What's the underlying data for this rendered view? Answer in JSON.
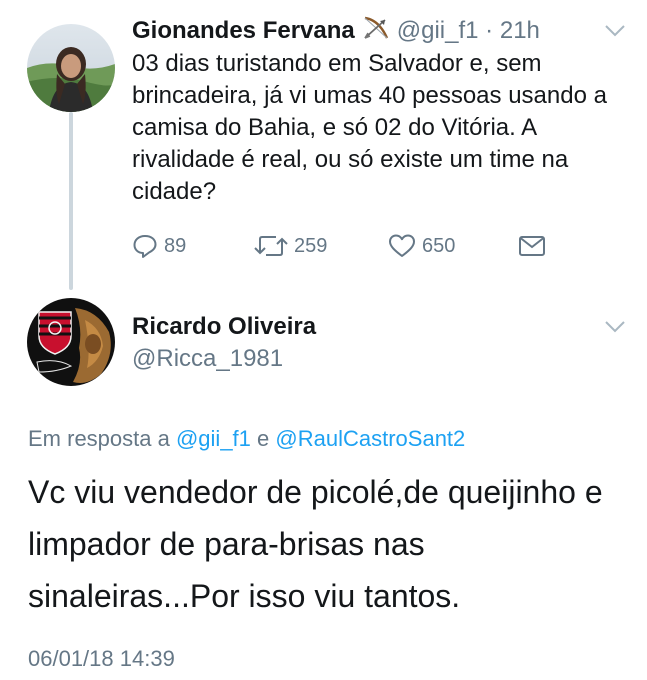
{
  "tweet1": {
    "display_name": "Gionandes Fervana",
    "emoji": "bow-and-arrow-icon",
    "handle": "@gii_f1",
    "separator": "·",
    "time": "21h",
    "text": "03 dias turistando em Salvador e, sem brincadeira, já vi umas 40 pessoas usando a camisa do Bahia, e só 02 do Vitória. A rivalidade é real, ou só existe um time na cidade?",
    "replies": "89",
    "retweets": "259",
    "likes": "650"
  },
  "tweet2": {
    "display_name": "Ricardo Oliveira",
    "handle": "@Ricca_1981",
    "reply_prefix": "Em resposta a",
    "reply_mention_1": "@gii_f1",
    "reply_conjunction": "e",
    "reply_mention_2": "@RaulCastroSant2",
    "text": "Vc viu vendedor de picolé,de queijinho e limpador de para-brisas nas sinaleiras...Por isso viu tantos.",
    "timestamp": "06/01/18 14:39"
  },
  "colors": {
    "text": "#14171a",
    "secondary": "#657786",
    "link": "#1da1f2",
    "thread_line": "#ccd6dd"
  }
}
